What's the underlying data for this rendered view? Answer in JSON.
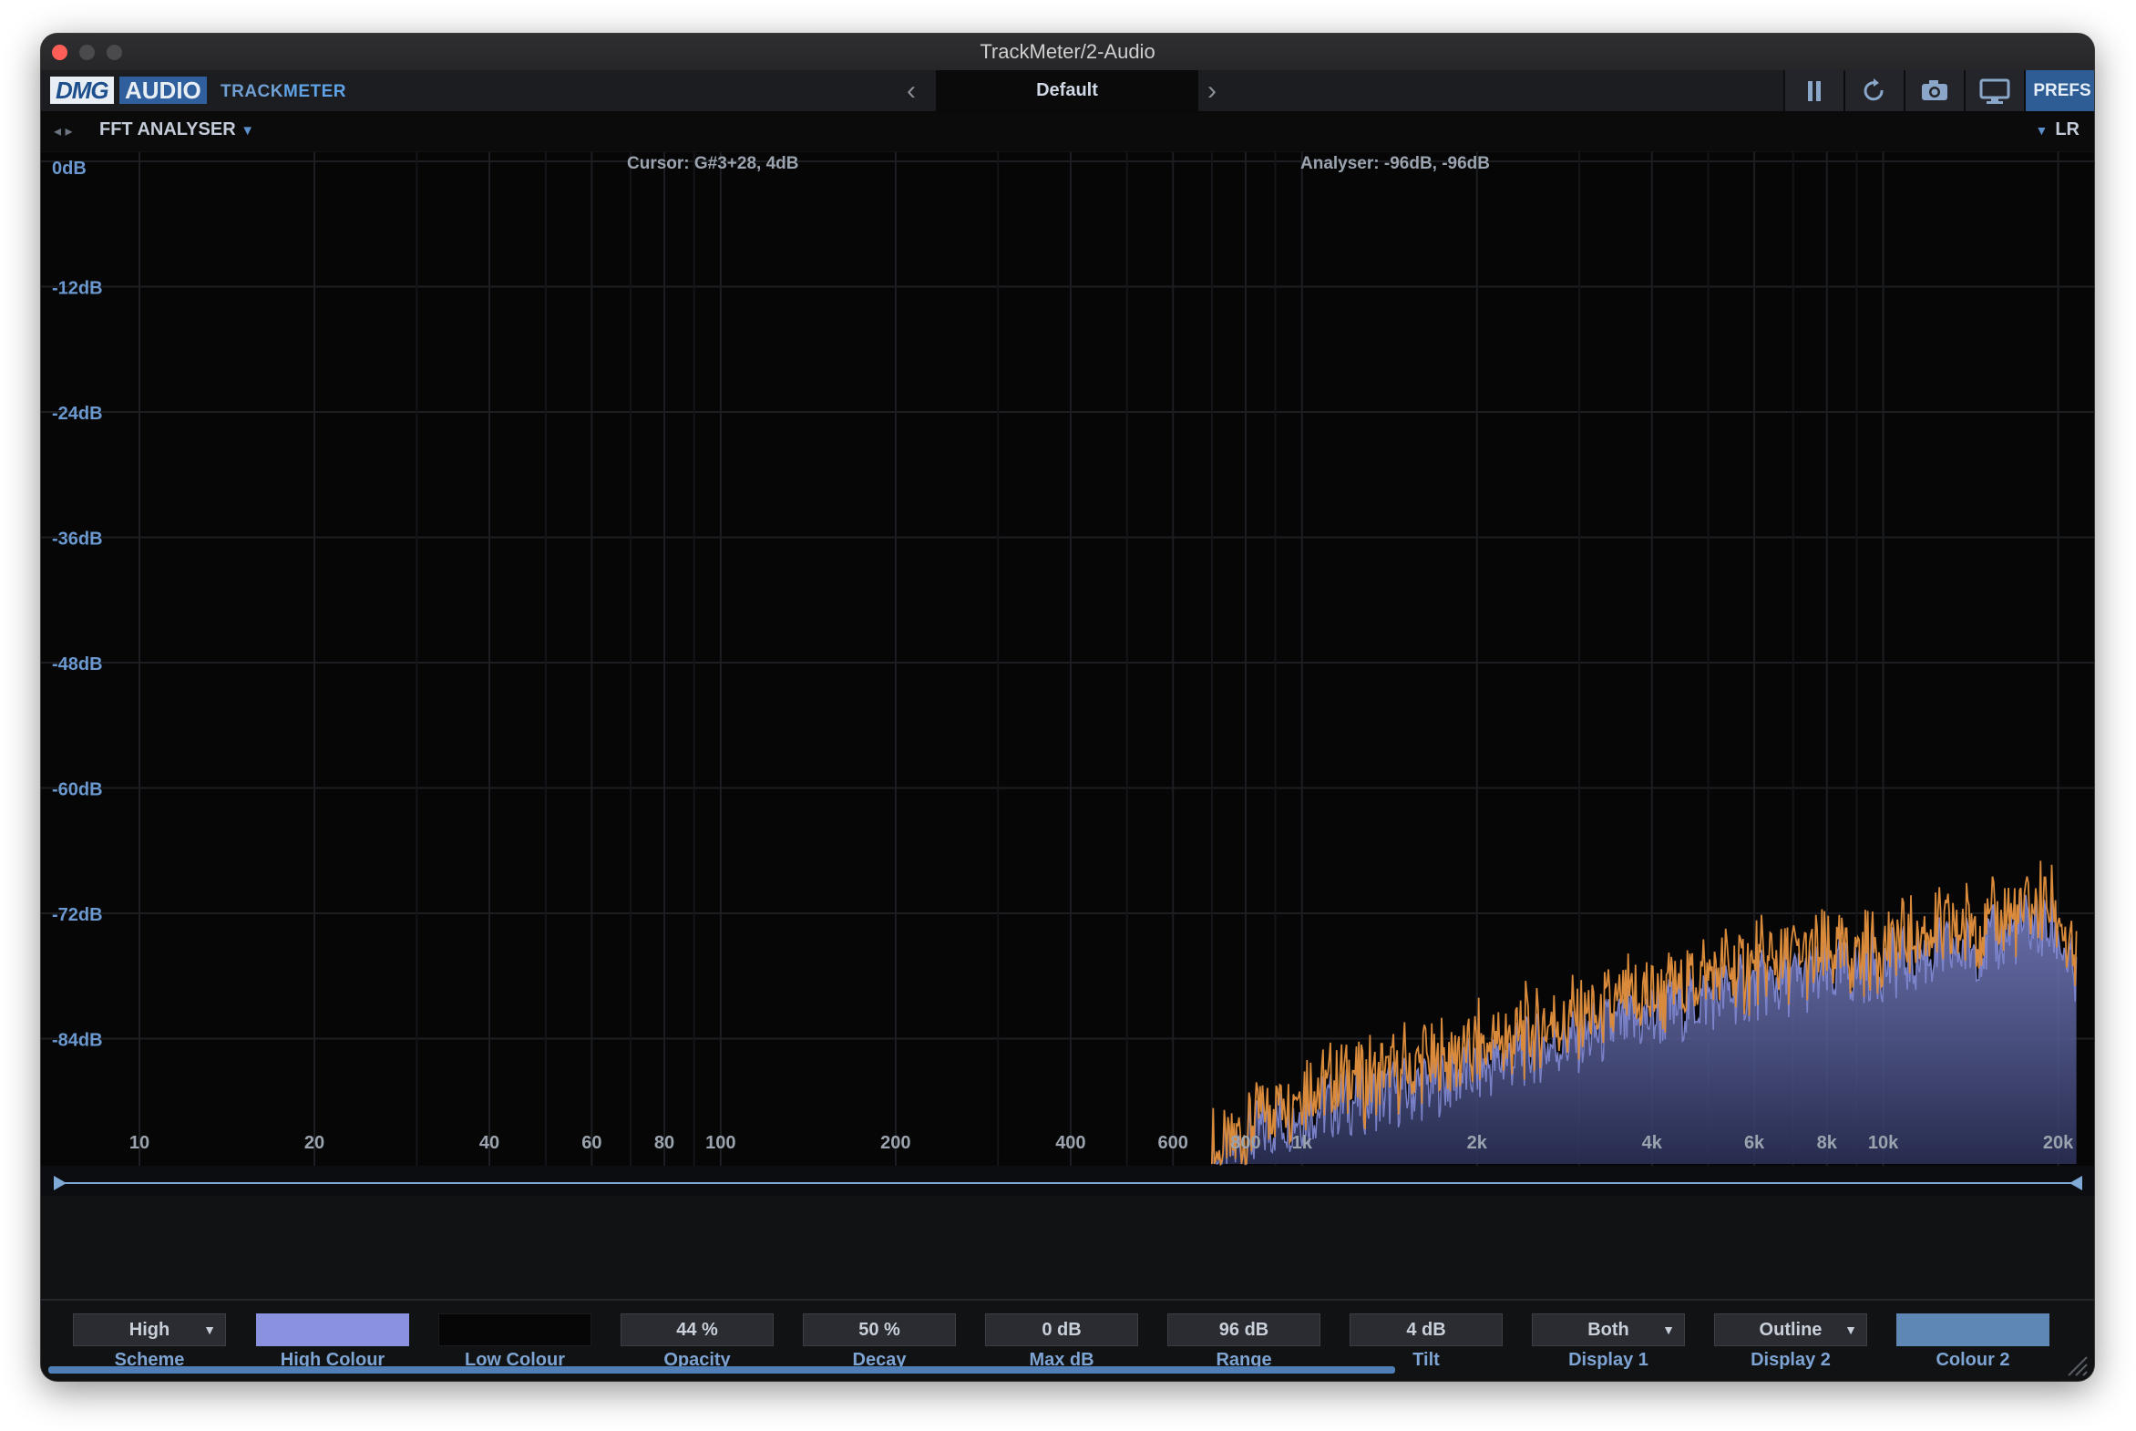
{
  "window": {
    "title": "TrackMeter/2-Audio"
  },
  "toolbar": {
    "logo_dmg": "DMG",
    "logo_audio": "AUDIO",
    "product_track": "TRACK",
    "product_meter": "METER",
    "preset_name": "Default",
    "prev_icon": "chevron-left-icon",
    "next_icon": "chevron-right-icon",
    "pause_icon": "pause-icon",
    "reset_icon": "refresh-icon",
    "snapshot_icon": "camera-icon",
    "display_icon": "monitor-icon",
    "prefs_label": "PREFS"
  },
  "subbar": {
    "module_title": "FFT ANALYSER",
    "channel": "LR"
  },
  "analyser": {
    "cursor_readout": "Cursor: G#3+28, 4dB",
    "analyser_readout": "Analyser: -96dB, -96dB",
    "colors": {
      "high": "#8a92e0",
      "outline": "#d98a3a",
      "fill_low": "#2a2f55",
      "grid": "#1c1e22",
      "label": "#6a98cf"
    }
  },
  "chart_data": {
    "type": "area",
    "x_scale": "log",
    "xlim": [
      6.3,
      22000
    ],
    "ylim": [
      -96,
      0
    ],
    "y_ticks": [
      {
        "v": 0,
        "label": "0dB"
      },
      {
        "v": -12,
        "label": "-12dB"
      },
      {
        "v": -24,
        "label": "-24dB"
      },
      {
        "v": -36,
        "label": "-36dB"
      },
      {
        "v": -48,
        "label": "-48dB"
      },
      {
        "v": -60,
        "label": "-60dB"
      },
      {
        "v": -72,
        "label": "-72dB"
      },
      {
        "v": -84,
        "label": "-84dB"
      }
    ],
    "x_ticks": [
      {
        "v": 10,
        "label": "10"
      },
      {
        "v": 20,
        "label": "20"
      },
      {
        "v": 40,
        "label": "40"
      },
      {
        "v": 60,
        "label": "60"
      },
      {
        "v": 80,
        "label": "80"
      },
      {
        "v": 100,
        "label": "100"
      },
      {
        "v": 200,
        "label": "200"
      },
      {
        "v": 400,
        "label": "400"
      },
      {
        "v": 600,
        "label": "600"
      },
      {
        "v": 800,
        "label": "800"
      },
      {
        "v": 1000,
        "label": "1k"
      },
      {
        "v": 2000,
        "label": "2k"
      },
      {
        "v": 4000,
        "label": "4k"
      },
      {
        "v": 6000,
        "label": "6k"
      },
      {
        "v": 8000,
        "label": "8k"
      },
      {
        "v": 10000,
        "label": "10k"
      },
      {
        "v": 20000,
        "label": "20k"
      }
    ],
    "x_minor": [
      30,
      50,
      70,
      90,
      300,
      500,
      700,
      900,
      3000,
      5000,
      7000,
      9000
    ],
    "spectrum": {
      "x": [
        700,
        800,
        900,
        1000,
        1200,
        1500,
        2000,
        2500,
        3000,
        4000,
        5000,
        6000,
        8000,
        10000,
        12000,
        15000,
        18000,
        20000,
        21500
      ],
      "y": [
        -96,
        -94,
        -92,
        -91,
        -90,
        -89,
        -87,
        -85,
        -84,
        -82,
        -80,
        -79,
        -78,
        -77,
        -76,
        -75,
        -73,
        -74,
        -79
      ]
    },
    "outline": {
      "x": [
        700,
        800,
        900,
        1000,
        1200,
        1500,
        2000,
        2500,
        3000,
        4000,
        5000,
        6000,
        8000,
        10000,
        12000,
        15000,
        18000,
        20000,
        21500
      ],
      "y": [
        -95,
        -93,
        -90,
        -89,
        -88,
        -87,
        -85,
        -83,
        -82,
        -80,
        -78,
        -77,
        -76,
        -75,
        -74,
        -73,
        -71,
        -72,
        -78
      ]
    }
  },
  "controls": [
    {
      "key": "scheme",
      "value": "High",
      "label": "Scheme",
      "dropdown": true
    },
    {
      "key": "high_colour",
      "value": "",
      "label": "High Colour",
      "swatch": "#8a92e0"
    },
    {
      "key": "low_colour",
      "value": "",
      "label": "Low Colour",
      "swatch": "#060607"
    },
    {
      "key": "opacity",
      "value": "44 %",
      "label": "Opacity"
    },
    {
      "key": "decay",
      "value": "50 %",
      "label": "Decay"
    },
    {
      "key": "max_db",
      "value": "0 dB",
      "label": "Max dB"
    },
    {
      "key": "range",
      "value": "96 dB",
      "label": "Range"
    },
    {
      "key": "tilt",
      "value": "4 dB",
      "label": "Tilt"
    },
    {
      "key": "display1",
      "value": "Both",
      "label": "Display 1",
      "dropdown": true
    },
    {
      "key": "display2",
      "value": "Outline",
      "label": "Display 2",
      "dropdown": true
    },
    {
      "key": "colour2",
      "value": "",
      "label": "Colour 2",
      "swatch": "#5e87b5"
    }
  ]
}
